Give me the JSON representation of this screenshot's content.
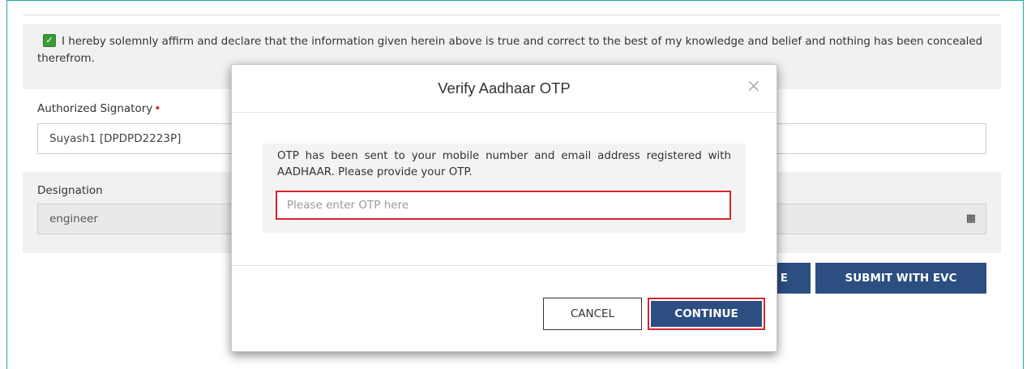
{
  "declaration": {
    "checked": true,
    "text": "I hereby solemnly affirm and declare that the information given herein above is true and correct to the best of my knowledge and belief and nothing has been concealed therefrom."
  },
  "signatory": {
    "label": "Authorized Signatory",
    "required_mark": "•",
    "value": "Suyash1 [DPDPD2223P]"
  },
  "designation": {
    "label": "Designation",
    "value": "engineer"
  },
  "actions": {
    "partial_button_label": "E",
    "submit_evc_label": "SUBMIT WITH EVC"
  },
  "modal": {
    "title": "Verify Aadhaar OTP",
    "close_glyph": "×",
    "message": "OTP has been sent to your mobile number and email address registered with AADHAAR. Please provide your OTP.",
    "otp_placeholder": "Please enter OTP here",
    "otp_value": "",
    "cancel_label": "CANCEL",
    "continue_label": "CONTINUE"
  },
  "icons": {
    "checkbox": "check-icon",
    "calendar": "calendar-icon",
    "close": "close-icon"
  },
  "colors": {
    "frame": "#1aa7a0",
    "primary_button": "#2c4e80",
    "highlight": "#d9232e",
    "checkbox": "#3a9a3a"
  }
}
